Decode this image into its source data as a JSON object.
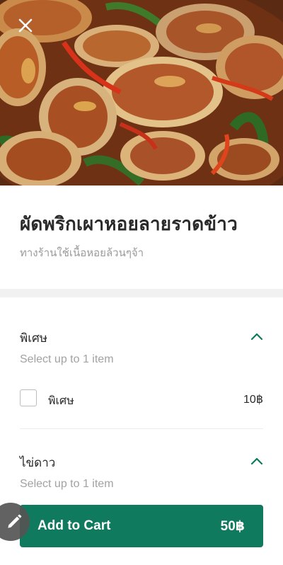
{
  "colors": {
    "accent": "#0f7a5e",
    "muted_text": "#9a9a9a",
    "fab": "#555555"
  },
  "header": {
    "image_icon": "food-photo",
    "close_icon": "close-icon"
  },
  "item": {
    "name": "ผัดพริกเผาหอยลายราดข้าว",
    "description": "ทางร้านใช้เนื้อหอยล้วนๆจ้า"
  },
  "option_groups": [
    {
      "title": "พิเศษ",
      "note": "Select up to 1 item",
      "expanded": true,
      "options": [
        {
          "label": "พิเศษ",
          "price": "10฿",
          "checked": false
        }
      ]
    },
    {
      "title": "ไข่ดาว",
      "note": "Select up to 1 item",
      "expanded": true
    }
  ],
  "cart": {
    "label": "Add to Cart",
    "price": "50฿"
  },
  "fab": {
    "icon": "pencil-icon"
  }
}
